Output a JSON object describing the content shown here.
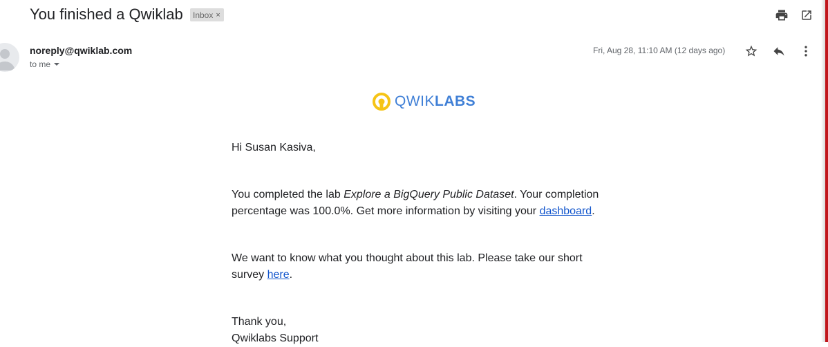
{
  "email": {
    "subject": "You finished a Qwiklab",
    "label": "Inbox",
    "label_remove": "×",
    "sender": "noreply@qwiklab.com",
    "recipient": "to me",
    "date": "Fri, Aug 28, 11:10 AM (12 days ago)"
  },
  "icons": {
    "print": "print-icon",
    "open_new_window": "open-in-new-window-icon",
    "star": "star-icon",
    "reply": "reply-icon",
    "more": "more-vert-icon"
  },
  "logo": {
    "text_light": "QWIK",
    "text_bold": "LABS"
  },
  "message": {
    "greeting": "Hi Susan Kasiva,",
    "p1_before": "You completed the lab ",
    "p1_lab": "Explore a BigQuery Public Dataset",
    "p1_middle": ". Your completion percentage was 100.0%. Get more information by visiting your ",
    "p1_link": "dashboard",
    "p1_end": ".",
    "p2_before": "We want to know what you thought about this lab. Please take our short survey ",
    "p2_link": "here",
    "p2_end": ".",
    "closing": "Thank you,",
    "signature": "Qwiklabs Support"
  },
  "colors": {
    "link": "#1155cc",
    "logo_blue": "#3f7fd6",
    "logo_yellow": "#f6c416",
    "edge_red": "#c0161c"
  }
}
